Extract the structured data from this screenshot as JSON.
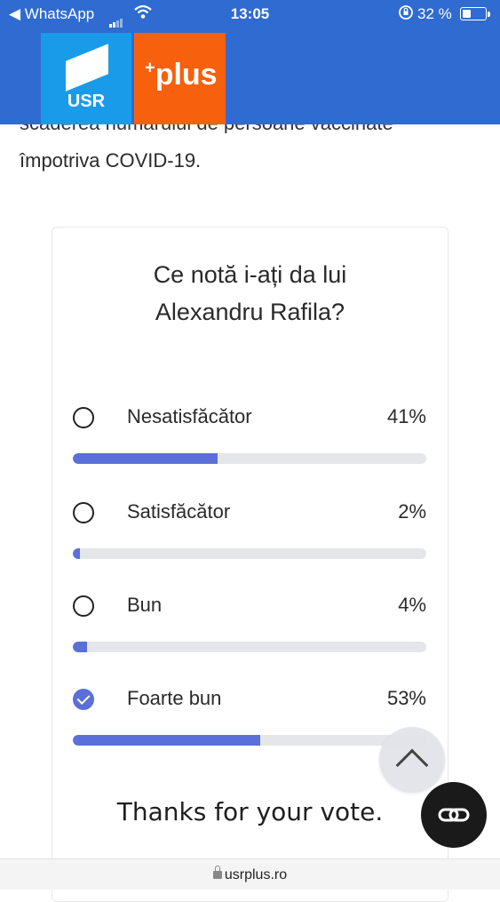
{
  "status_bar": {
    "back_app": "◀ WhatsApp",
    "time": "13:05",
    "battery_pct": "32 %"
  },
  "header": {
    "logo_usr": "USR",
    "logo_plus_prefix": "+",
    "logo_plus": "plus"
  },
  "article": {
    "partial_line": "scaderea numarului de persoane vaccinate",
    "intro_line": "împotriva COVID-19."
  },
  "poll": {
    "question_line1": "Ce notă i-ați da lui",
    "question_line2": "Alexandru Rafila?",
    "options": [
      {
        "label": "Nesatisfăcător",
        "percent": "41%",
        "fraction": 0.41,
        "selected": false
      },
      {
        "label": "Satisfăcător",
        "percent": "2%",
        "fraction": 0.02,
        "selected": false
      },
      {
        "label": "Bun",
        "percent": "4%",
        "fraction": 0.04,
        "selected": false
      },
      {
        "label": "Foarte bun",
        "percent": "53%",
        "fraction": 0.53,
        "selected": true
      }
    ],
    "thanks": "Thanks for your vote."
  },
  "url_bar": {
    "url": "usrplus.ro"
  },
  "colors": {
    "header_blue": "#2f6bd0",
    "usr_blue": "#1a9bea",
    "plus_orange": "#f7600c",
    "bar_fill": "#5b6fd8",
    "bar_track": "#e5e6ea"
  },
  "icons": {
    "radio": "radio-circle-icon",
    "checked": "check-circle-icon",
    "scroll_top": "chevron-up-icon",
    "tab_switch": "tab-switch-icon",
    "lock": "lock-icon"
  }
}
